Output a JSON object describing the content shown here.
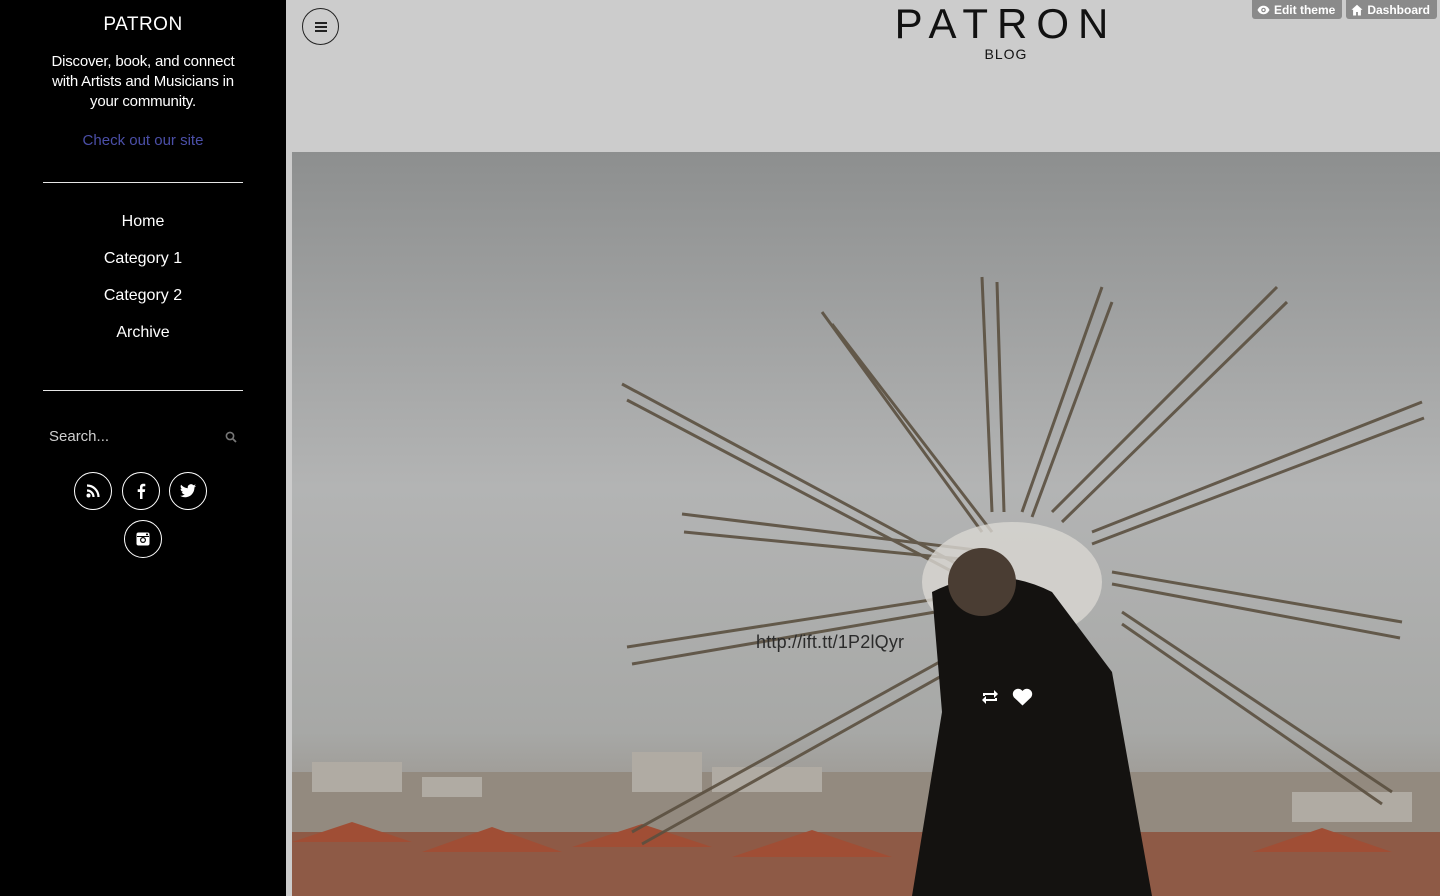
{
  "sidebar": {
    "site_name": "PATRON",
    "tagline": "Discover, book, and connect with Artists and Musicians in your community.",
    "site_link": "Check out our site",
    "nav": [
      {
        "label": "Home"
      },
      {
        "label": "Category 1"
      },
      {
        "label": "Category 2"
      },
      {
        "label": "Archive"
      }
    ],
    "search": {
      "placeholder": "Search..."
    },
    "social_icons": [
      "rss-icon",
      "facebook-icon",
      "twitter-icon",
      "instagram-icon"
    ]
  },
  "header": {
    "logo_title": "PATRON",
    "logo_subtitle": "BLOG",
    "controls": [
      {
        "label": "Edit theme",
        "icon": "eye-icon"
      },
      {
        "label": "Dashboard",
        "icon": "home-icon"
      }
    ]
  },
  "post": {
    "link_text": "http://ift.tt/1P2lQyr",
    "actions": [
      "reblog-icon",
      "heart-icon"
    ]
  },
  "colors": {
    "sidebar_bg": "#000000",
    "page_bg": "#cccccc",
    "link": "#4b4fa8",
    "control_bg": "#8a8a8a"
  }
}
